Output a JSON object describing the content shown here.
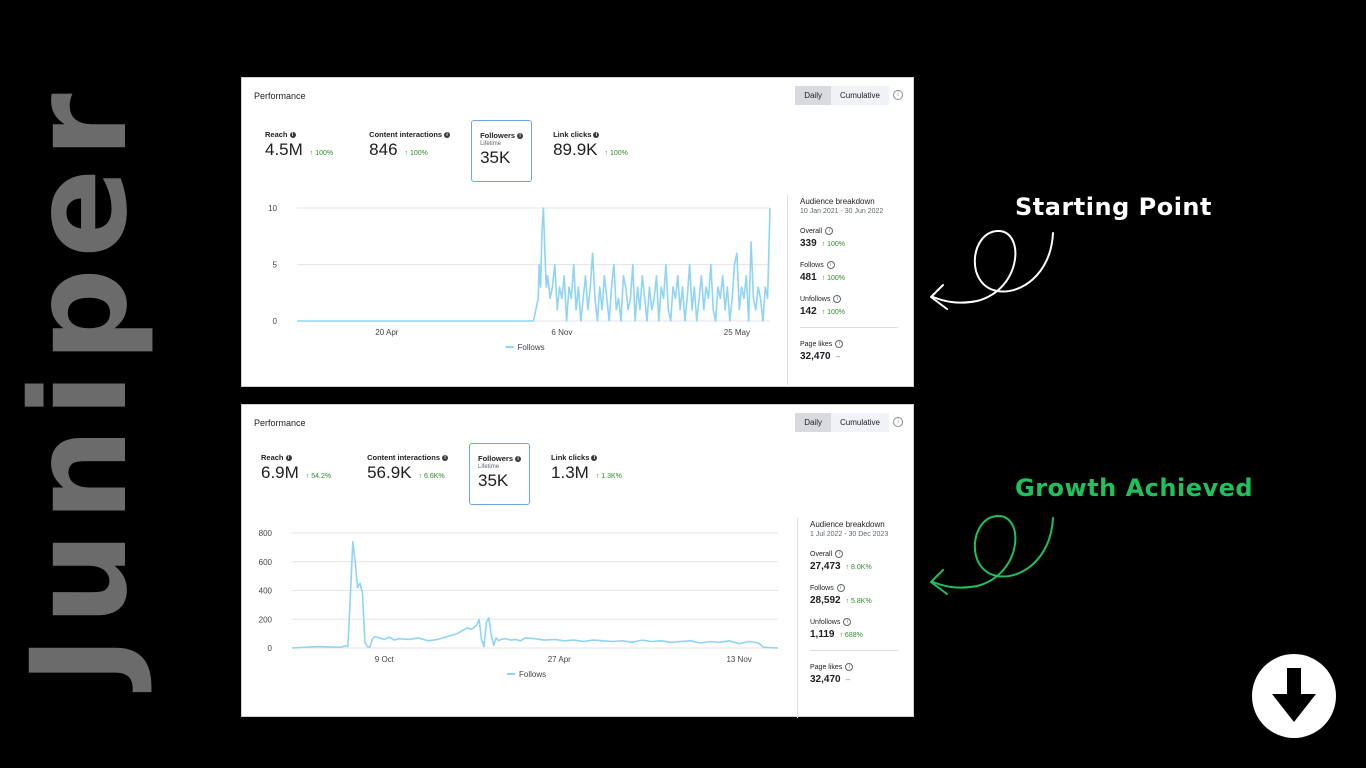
{
  "brand": "Juniper",
  "callouts": {
    "starting": "Starting Point",
    "growth": "Growth Achieved"
  },
  "colors": {
    "follows_line": "#8fd4f5",
    "positive_change": "#2e8b2e",
    "growth_callout": "#20c05c"
  },
  "panels": [
    {
      "title": "Performance",
      "toggle": {
        "daily": "Daily",
        "cumulative": "Cumulative",
        "active": "Daily"
      },
      "metrics": [
        {
          "label": "Reach",
          "value": "4.5M",
          "change": "↑ 100%"
        },
        {
          "label": "Content interactions",
          "value": "846",
          "change": "↑ 100%"
        },
        {
          "label": "Followers",
          "sublabel": "Lifetime",
          "value": "35K",
          "change": "",
          "selected": true
        },
        {
          "label": "Link clicks",
          "value": "89.9K",
          "change": "↑ 100%"
        }
      ],
      "sidebar": {
        "title": "Audience breakdown",
        "date_range": "10 Jan 2021 - 30 Jun 2022",
        "overall": {
          "label": "Overall",
          "value": "339",
          "change": "↑ 100%"
        },
        "follows": {
          "label": "Follows",
          "value": "481",
          "change": "↑ 100%"
        },
        "unfollows": {
          "label": "Unfollows",
          "value": "142",
          "change": "↑ 100%"
        },
        "page_likes": {
          "label": "Page likes",
          "value": "32,470",
          "change": "--"
        }
      }
    },
    {
      "title": "Performance",
      "toggle": {
        "daily": "Daily",
        "cumulative": "Cumulative",
        "active": "Daily"
      },
      "metrics": [
        {
          "label": "Reach",
          "value": "6.9M",
          "change": "↑ 54.2%"
        },
        {
          "label": "Content interactions",
          "value": "56.9K",
          "change": "↑ 6.6K%"
        },
        {
          "label": "Followers",
          "sublabel": "Lifetime",
          "value": "35K",
          "change": "",
          "selected": true
        },
        {
          "label": "Link clicks",
          "value": "1.3M",
          "change": "↑ 1.3K%"
        }
      ],
      "sidebar": {
        "title": "Audience breakdown",
        "date_range": "1 Jul 2022 - 30 Dec 2023",
        "overall": {
          "label": "Overall",
          "value": "27,473",
          "change": "↑ 8.0K%"
        },
        "follows": {
          "label": "Follows",
          "value": "28,592",
          "change": "↑ 5.8K%"
        },
        "unfollows": {
          "label": "Unfollows",
          "value": "1,119",
          "change": "↑ 688%"
        },
        "page_likes": {
          "label": "Page likes",
          "value": "32,470",
          "change": "--"
        }
      }
    }
  ],
  "chart_data": [
    {
      "type": "line",
      "series": [
        {
          "name": "Follows"
        }
      ],
      "y_ticks": [
        "10",
        "5",
        "0"
      ],
      "ylim": [
        0,
        10
      ],
      "x_ticks": [
        "20 Apr",
        "6 Nov",
        "25 May"
      ],
      "x": [
        0,
        0.03,
        0.06,
        0.09,
        0.12,
        0.15,
        0.18,
        0.21,
        0.24,
        0.27,
        0.3,
        0.33,
        0.36,
        0.39,
        0.42,
        0.45,
        0.48,
        0.5,
        0.51,
        0.512,
        0.515,
        0.518,
        0.521,
        0.524,
        0.527,
        0.53,
        0.535,
        0.54,
        0.545,
        0.55,
        0.555,
        0.56,
        0.565,
        0.57,
        0.575,
        0.58,
        0.585,
        0.59,
        0.595,
        0.6,
        0.605,
        0.61,
        0.615,
        0.62,
        0.625,
        0.63,
        0.635,
        0.64,
        0.645,
        0.65,
        0.655,
        0.66,
        0.665,
        0.67,
        0.675,
        0.68,
        0.685,
        0.69,
        0.695,
        0.7,
        0.705,
        0.71,
        0.715,
        0.72,
        0.725,
        0.73,
        0.735,
        0.74,
        0.745,
        0.75,
        0.755,
        0.76,
        0.765,
        0.77,
        0.775,
        0.78,
        0.785,
        0.79,
        0.795,
        0.8,
        0.805,
        0.81,
        0.815,
        0.82,
        0.825,
        0.83,
        0.835,
        0.84,
        0.845,
        0.85,
        0.855,
        0.86,
        0.865,
        0.87,
        0.875,
        0.88,
        0.885,
        0.89,
        0.895,
        0.9,
        0.905,
        0.91,
        0.915,
        0.92,
        0.925,
        0.93,
        0.935,
        0.94,
        0.945,
        0.95,
        0.955,
        0.96,
        0.965,
        0.97,
        0.975,
        0.98,
        0.985,
        0.99,
        0.995,
        1.0
      ],
      "values": [
        0,
        0,
        0,
        0,
        0,
        0,
        0,
        0,
        0,
        0,
        0,
        0,
        0,
        0,
        0,
        0,
        0,
        0,
        2,
        5,
        3,
        8,
        10,
        6,
        3,
        4,
        2,
        3,
        5,
        1,
        3,
        2,
        4,
        0,
        3,
        2,
        5,
        1,
        3,
        0,
        2,
        4,
        1,
        3,
        6,
        2,
        0,
        3,
        1,
        4,
        2,
        0,
        3,
        5,
        1,
        2,
        0,
        4,
        3,
        1,
        2,
        5,
        0,
        3,
        1,
        4,
        2,
        0,
        3,
        1,
        2,
        4,
        0,
        3,
        2,
        5,
        1,
        0,
        3,
        2,
        4,
        1,
        3,
        0,
        2,
        5,
        1,
        3,
        0,
        2,
        4,
        1,
        3,
        2,
        5,
        1,
        0,
        3,
        2,
        4,
        1,
        3,
        0,
        2,
        5,
        6,
        1,
        3,
        2,
        4,
        0,
        7,
        2,
        1,
        3,
        2,
        0,
        3,
        2,
        10
      ]
    },
    {
      "type": "line",
      "series": [
        {
          "name": "Follows"
        }
      ],
      "y_ticks": [
        "800",
        "600",
        "400",
        "200",
        "0"
      ],
      "ylim": [
        0,
        800
      ],
      "x_ticks": [
        "9 Oct",
        "27 Apr",
        "13 Nov"
      ],
      "x": [
        0,
        0.05,
        0.1,
        0.11,
        0.115,
        0.12,
        0.125,
        0.13,
        0.135,
        0.14,
        0.145,
        0.15,
        0.155,
        0.16,
        0.165,
        0.17,
        0.18,
        0.19,
        0.2,
        0.21,
        0.22,
        0.24,
        0.26,
        0.28,
        0.3,
        0.32,
        0.34,
        0.35,
        0.36,
        0.37,
        0.38,
        0.385,
        0.39,
        0.395,
        0.4,
        0.405,
        0.41,
        0.415,
        0.42,
        0.425,
        0.43,
        0.44,
        0.45,
        0.46,
        0.47,
        0.48,
        0.5,
        0.52,
        0.54,
        0.56,
        0.58,
        0.6,
        0.62,
        0.64,
        0.66,
        0.68,
        0.7,
        0.72,
        0.74,
        0.76,
        0.78,
        0.8,
        0.82,
        0.84,
        0.86,
        0.88,
        0.9,
        0.92,
        0.94,
        0.96,
        0.97,
        1.0
      ],
      "values": [
        0,
        10,
        5,
        15,
        10,
        350,
        740,
        600,
        420,
        450,
        380,
        40,
        10,
        5,
        60,
        80,
        70,
        60,
        75,
        55,
        65,
        60,
        70,
        50,
        60,
        80,
        100,
        120,
        140,
        130,
        160,
        200,
        60,
        10,
        180,
        210,
        90,
        20,
        70,
        50,
        60,
        65,
        55,
        60,
        50,
        70,
        65,
        55,
        60,
        50,
        55,
        45,
        55,
        50,
        45,
        50,
        40,
        55,
        45,
        50,
        40,
        45,
        50,
        35,
        45,
        40,
        50,
        30,
        45,
        35,
        5,
        0
      ]
    }
  ]
}
